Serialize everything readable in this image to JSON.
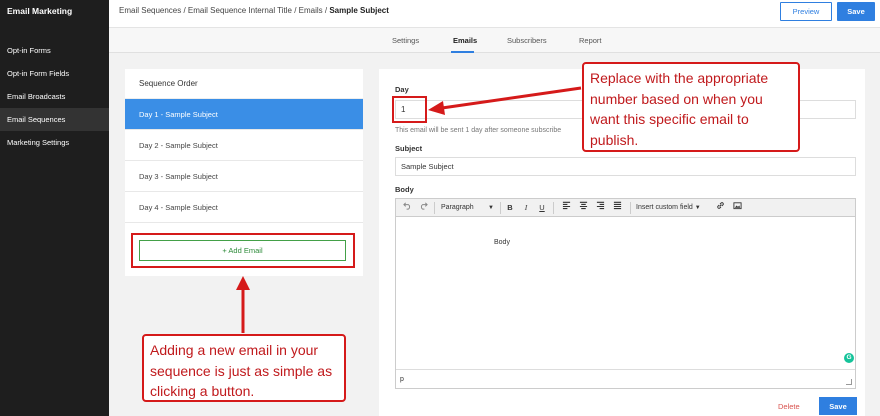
{
  "sidebar": {
    "title": "Email Marketing",
    "items": [
      {
        "label": "Opt-in Forms",
        "active": false
      },
      {
        "label": "Opt-in Form Fields",
        "active": false
      },
      {
        "label": "Email Broadcasts",
        "active": false
      },
      {
        "label": "Email Sequences",
        "active": true
      },
      {
        "label": "Marketing Settings",
        "active": false
      }
    ]
  },
  "header": {
    "breadcrumb_path": "Email Sequences / Email Sequence Internal Title / Emails / ",
    "breadcrumb_current": "Sample Subject",
    "preview_label": "Preview",
    "save_label": "Save"
  },
  "tabs": [
    {
      "label": "Settings",
      "active": false
    },
    {
      "label": "Emails",
      "active": true
    },
    {
      "label": "Subscribers",
      "active": false
    },
    {
      "label": "Report",
      "active": false
    }
  ],
  "sequence": {
    "header": "Sequence Order",
    "items": [
      {
        "label": "Day 1 - Sample Subject",
        "active": true
      },
      {
        "label": "Day 2 - Sample Subject",
        "active": false
      },
      {
        "label": "Day 3 - Sample Subject",
        "active": false
      },
      {
        "label": "Day 4 - Sample Subject",
        "active": false
      }
    ],
    "add_email_label": "+ Add Email"
  },
  "form": {
    "day_label": "Day",
    "day_value": "1",
    "helper_text": "This email will be sent 1 day after someone subscribe",
    "subject_label": "Subject",
    "subject_value": "Sample Subject",
    "body_label": "Body",
    "editor": {
      "undo_icon": "undo-icon",
      "redo_icon": "redo-icon",
      "format_select": "Paragraph",
      "bold": "B",
      "italic": "I",
      "underline": "U",
      "custom_field": "Insert custom field",
      "body_text": "Body",
      "status_path": "p"
    },
    "delete_label": "Delete",
    "save_label": "Save"
  },
  "callouts": {
    "day_hint": "Replace with the appropriate number based on when you want this specific email to publish.",
    "add_hint": "Adding a new email in your sequence is just as simple as clicking a button."
  },
  "colors": {
    "accent": "#2f7fe0",
    "sidebar_bg": "#1e1e1e",
    "active_item": "#3a8ee6",
    "annotation_red": "#d51a1a",
    "add_green": "#43a047"
  }
}
